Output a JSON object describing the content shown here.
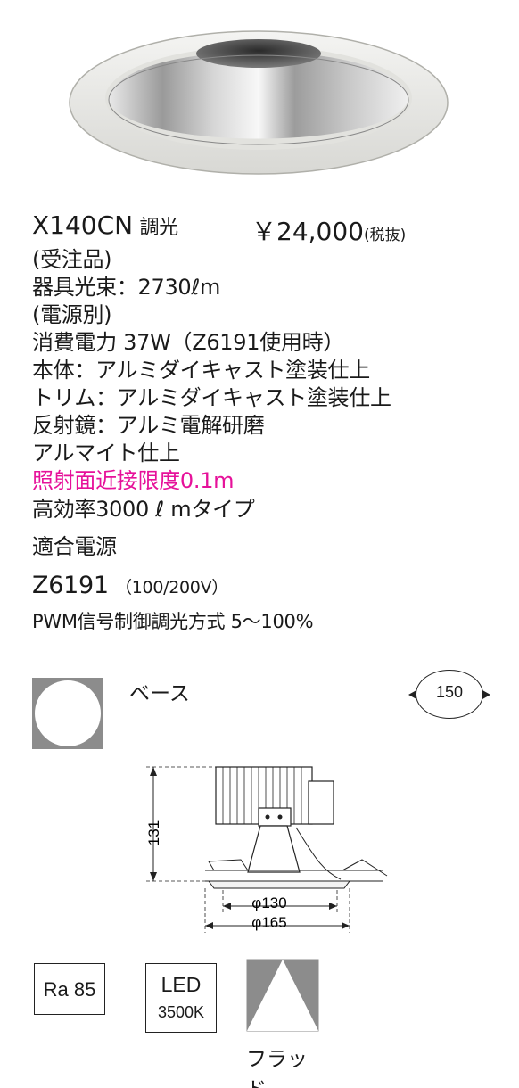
{
  "product": {
    "model": "X140CN",
    "model_suffix": "調光",
    "price": "￥24,000",
    "price_note": "(税抜)",
    "order_note": "(受注品)"
  },
  "specs": {
    "flux": "器具光束：2730ℓm",
    "power_note": "(電源別)",
    "consumption": "消費電力 37W（Z6191使用時）",
    "body": "本体：アルミダイキャスト塗装仕上",
    "trim": "トリム：アルミダイキャスト塗装仕上",
    "reflector": "反射鏡：アルミ電解研磨",
    "reflector_finish": "アルマイト仕上",
    "proximity": "照射面近接限度0.1m",
    "type": "高効率3000 ℓ mタイプ"
  },
  "power_supply": {
    "heading": "適合電源",
    "model": "Z6191",
    "voltage": "（100/200V）",
    "dimming": "PWM信号制御調光方式 5〜100%"
  },
  "base": {
    "label": "ベース"
  },
  "cutout": {
    "value": "150"
  },
  "dimensions": {
    "height": "131",
    "inner": "φ130",
    "outer": "φ165"
  },
  "badges": {
    "ra": "Ra 85",
    "led": "LED",
    "cct": "3500K"
  },
  "beam": {
    "label": "フラッド"
  },
  "colors": {
    "accent": "#e6119a",
    "icon_gray": "#8c8c8c"
  }
}
